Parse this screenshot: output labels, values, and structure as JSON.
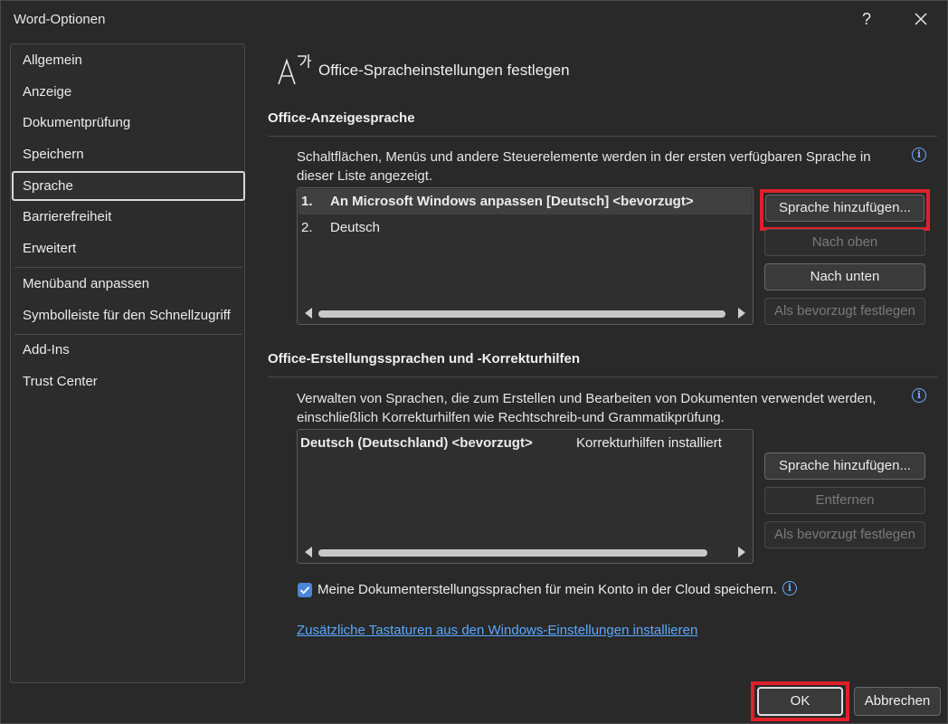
{
  "window": {
    "title": "Word-Optionen",
    "help_label": "?",
    "close_label": "✕"
  },
  "sidebar": {
    "items": [
      {
        "label": "Allgemein"
      },
      {
        "label": "Anzeige"
      },
      {
        "label": "Dokumentprüfung"
      },
      {
        "label": "Speichern"
      },
      {
        "label": "Sprache",
        "active": true
      },
      {
        "label": "Barrierefreiheit"
      },
      {
        "label": "Erweitert"
      },
      {
        "label": "Menüband anpassen"
      },
      {
        "label": "Symbolleiste für den Schnellzugriff"
      },
      {
        "label": "Add-Ins"
      },
      {
        "label": "Trust Center"
      }
    ]
  },
  "main": {
    "page_title": "Office-Spracheinstellungen festlegen",
    "display_section": {
      "heading": "Office-Anzeigesprache",
      "description": "Schaltflächen, Menüs und andere Steuerelemente werden in der ersten verfügbaren Sprache in dieser Liste angezeigt.",
      "list": [
        {
          "num": "1.",
          "text": "An Microsoft Windows anpassen [Deutsch] <bevorzugt>"
        },
        {
          "num": "2.",
          "text": "Deutsch"
        }
      ],
      "buttons": {
        "add": "Sprache hinzufügen...",
        "up": "Nach oben",
        "down": "Nach unten",
        "preferred": "Als bevorzugt festlegen"
      }
    },
    "authoring_section": {
      "heading": "Office-Erstellungssprachen und -Korrekturhilfen",
      "description": "Verwalten von Sprachen, die zum Erstellen und Bearbeiten von Dokumenten verwendet werden, einschließlich Korrekturhilfen wie Rechtschreib-und Grammatikprüfung.",
      "list": [
        {
          "language": "Deutsch (Deutschland) <bevorzugt>",
          "status": "Korrekturhilfen installiert"
        }
      ],
      "buttons": {
        "add": "Sprache hinzufügen...",
        "remove": "Entfernen",
        "preferred": "Als bevorzugt festlegen"
      }
    },
    "cloud_checkbox": {
      "label": "Meine Dokumenterstellungssprachen für mein Konto in der Cloud speichern.",
      "checked": true
    },
    "keyboard_link": "Zusätzliche Tastaturen aus den Windows-Einstellungen installieren"
  },
  "footer": {
    "ok": "OK",
    "cancel": "Abbrechen"
  },
  "colors": {
    "accent": "#4a86d8",
    "link": "#5aa9ff",
    "highlight_box": "#e0202a"
  }
}
